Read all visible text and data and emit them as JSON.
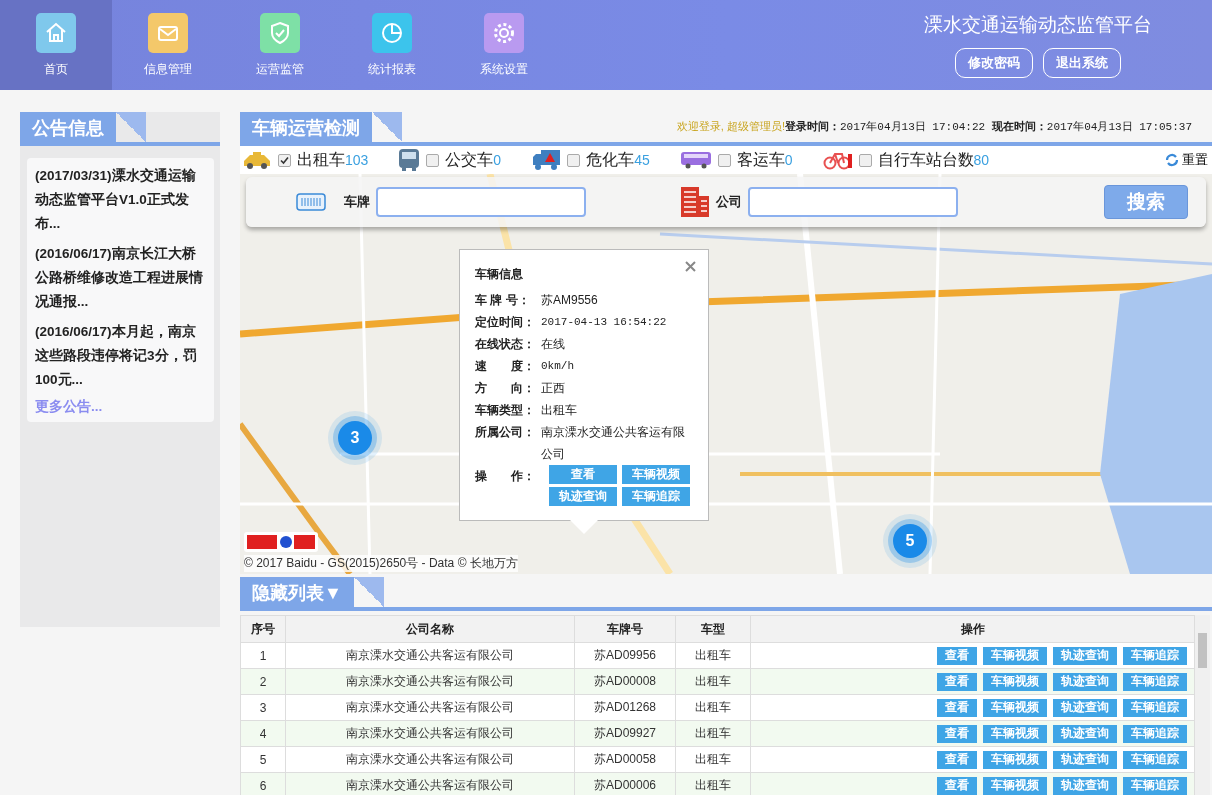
{
  "nav": {
    "items": [
      {
        "label": "首页",
        "kind": "home",
        "color": "#7fc8ec",
        "selected": true
      },
      {
        "label": "信息管理",
        "kind": "mail",
        "color": "#f4c86a",
        "selected": false
      },
      {
        "label": "运营监管",
        "kind": "shield",
        "color": "#7ee0a6",
        "selected": false
      },
      {
        "label": "统计报表",
        "kind": "chart",
        "color": "#3cc4ec",
        "selected": false
      },
      {
        "label": "系统设置",
        "kind": "gear",
        "color": "#b99af0",
        "selected": false
      }
    ],
    "title": "溧水交通运输动态监管平台",
    "buttons": [
      "修改密码",
      "退出系统"
    ]
  },
  "notice": {
    "title": "公告信息",
    "items": [
      "(2017/03/31)溧水交通运输动态监管平台V1.0正式发布...",
      "(2016/06/17)南京长江大桥公路桥维修改造工程进展情况通报...",
      "(2016/06/17)本月起，南京这些路段违停将记3分，罚100元..."
    ],
    "more": "更多公告..."
  },
  "monitor": {
    "title": "车辆运营检测",
    "welcome": "欢迎登录, 超级管理员!",
    "login_label": "登录时间：",
    "login_time": "2017年04月13日 17:04:22",
    "now_label": "现在时间：",
    "now_time": "2017年04月13日 17:05:37"
  },
  "filters": [
    {
      "kind": "taxi",
      "label": "出租车",
      "count": "103",
      "checked": true
    },
    {
      "kind": "bus",
      "label": "公交车",
      "count": "0",
      "checked": false
    },
    {
      "kind": "hazard",
      "label": "危化车",
      "count": "45",
      "checked": false
    },
    {
      "kind": "coach",
      "label": "客运车",
      "count": "0",
      "checked": false
    },
    {
      "kind": "bike",
      "label": "自行车站台数",
      "count": "80",
      "checked": false
    }
  ],
  "reset": "重置",
  "search": {
    "plate_label": "车牌",
    "company_label": "公司",
    "button": "搜索"
  },
  "map": {
    "clusters": [
      "3",
      "5"
    ],
    "attribution": "© 2017 Baidu - GS(2015)2650号 - Data © 长地万方"
  },
  "popup": {
    "title": "车辆信息",
    "fields": [
      {
        "label": "车 牌 号：",
        "value": "苏AM9556"
      },
      {
        "label": "定位时间：",
        "value": "2017-04-13 16:54:22"
      },
      {
        "label": "在线状态：",
        "value": "在线"
      },
      {
        "label": "速　　度：",
        "value": "0km/h"
      },
      {
        "label": "方　　向：",
        "value": "正西"
      },
      {
        "label": "车辆类型：",
        "value": "出租车"
      },
      {
        "label": "所属公司：",
        "value": "南京溧水交通公共客运有限公司"
      }
    ],
    "actions_label": "操　　作：",
    "actions": [
      "查看",
      "车辆视频",
      "轨迹查询",
      "车辆追踪"
    ]
  },
  "list": {
    "title": "隐藏列表▼",
    "columns": [
      "序号",
      "公司名称",
      "车牌号",
      "车型",
      "操作"
    ],
    "rows": [
      {
        "no": "1",
        "company": "南京溧水交通公共客运有限公司",
        "plate": "苏AD09956",
        "type": "出租车",
        "actions": [
          "查看",
          "车辆视频",
          "轨迹查询",
          "车辆追踪"
        ]
      },
      {
        "no": "2",
        "company": "南京溧水交通公共客运有限公司",
        "plate": "苏AD00008",
        "type": "出租车",
        "actions": [
          "查看",
          "车辆视频",
          "轨迹查询",
          "车辆追踪"
        ]
      },
      {
        "no": "3",
        "company": "南京溧水交通公共客运有限公司",
        "plate": "苏AD01268",
        "type": "出租车",
        "actions": [
          "查看",
          "车辆视频",
          "轨迹查询",
          "车辆追踪"
        ]
      },
      {
        "no": "4",
        "company": "南京溧水交通公共客运有限公司",
        "plate": "苏AD09927",
        "type": "出租车",
        "actions": [
          "查看",
          "车辆视频",
          "轨迹查询",
          "车辆追踪"
        ]
      },
      {
        "no": "5",
        "company": "南京溧水交通公共客运有限公司",
        "plate": "苏AD00058",
        "type": "出租车",
        "actions": [
          "查看",
          "车辆视频",
          "轨迹查询",
          "车辆追踪"
        ]
      },
      {
        "no": "6",
        "company": "南京溧水交通公共客运有限公司",
        "plate": "苏AD00006",
        "type": "出租车",
        "actions": [
          "查看",
          "车辆视频",
          "轨迹查询",
          "车辆追踪"
        ]
      }
    ]
  }
}
